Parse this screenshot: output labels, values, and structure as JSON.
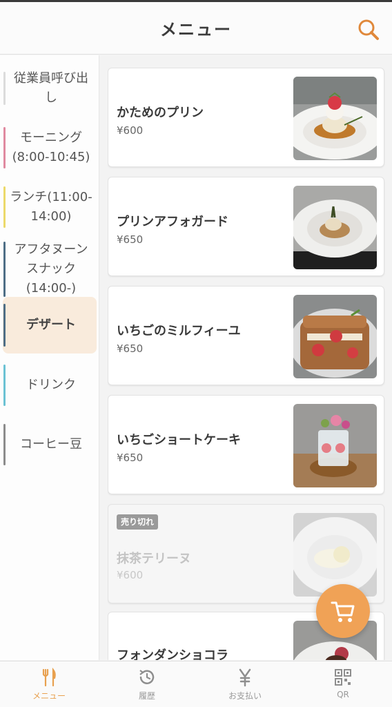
{
  "header": {
    "title": "メニュー",
    "search_icon": "search-icon"
  },
  "sidebar": {
    "items": [
      {
        "label": "従業員呼び出し",
        "color": "#dcdcdc"
      },
      {
        "label": "モーニング(8:00-10:45)",
        "color": "#e08aa0"
      },
      {
        "label": "ランチ(11:00-14:00)",
        "color": "#ecd96a"
      },
      {
        "label": "アフタヌーンスナック(14:00-)",
        "color": "#4e6e86"
      },
      {
        "label": "デザート",
        "color": "#4e6e86"
      },
      {
        "label": "ドリンク",
        "color": "#6cc2d4"
      },
      {
        "label": "コーヒー豆",
        "color": "#8c8c8c"
      }
    ],
    "active": "デザート"
  },
  "menu_items": [
    {
      "name": "かためのプリン",
      "price": "¥600"
    },
    {
      "name": "プリンアフォガード",
      "price": "¥650"
    },
    {
      "name": "いちごのミルフィーユ",
      "price": "¥650"
    },
    {
      "name": "いちごショートケーキ",
      "price": "¥650"
    },
    {
      "name": "抹茶テリーヌ",
      "price": "¥600",
      "badge": "売り切れ",
      "sold_out": true
    },
    {
      "name": "フォンダンショコラ",
      "price": ""
    }
  ],
  "cart": {
    "icon": "cart-icon"
  },
  "tabbar": {
    "items": [
      {
        "label": "メニュー",
        "icon": "fork-knife-icon",
        "active": true
      },
      {
        "label": "履歴",
        "icon": "history-icon"
      },
      {
        "label": "お支払い",
        "icon": "yen-icon"
      },
      {
        "label": "QR",
        "icon": "qr-code-icon"
      }
    ]
  },
  "colors": {
    "accent": "#f0a256",
    "active_bg": "#f9ebdc",
    "sold_out_badge": "#9a9a9a"
  }
}
